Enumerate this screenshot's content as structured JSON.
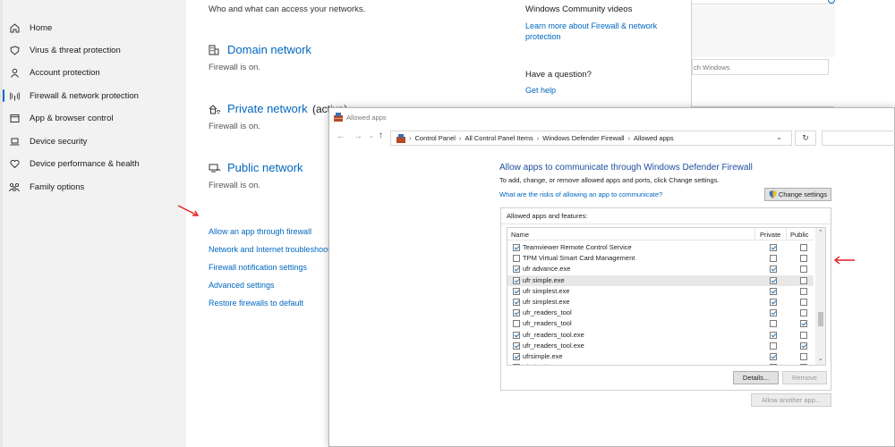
{
  "nav": {
    "items": [
      {
        "label": "Home",
        "icon": "home-icon",
        "active": false
      },
      {
        "label": "Virus & threat protection",
        "icon": "shield-icon",
        "active": false
      },
      {
        "label": "Account protection",
        "icon": "person-icon",
        "active": false
      },
      {
        "label": "Firewall & network protection",
        "icon": "antenna-icon",
        "active": true
      },
      {
        "label": "App & browser control",
        "icon": "app-window-icon",
        "active": false
      },
      {
        "label": "Device security",
        "icon": "laptop-icon",
        "active": false
      },
      {
        "label": "Device performance & health",
        "icon": "heart-icon",
        "active": false
      },
      {
        "label": "Family options",
        "icon": "family-icon",
        "active": false
      }
    ]
  },
  "main": {
    "intro": "Who and what can access your networks.",
    "networks": [
      {
        "title": "Domain network",
        "status": "Firewall is on.",
        "suffix": "",
        "icon": "domain-network-icon"
      },
      {
        "title": "Private network",
        "status": "Firewall is on.",
        "suffix": "(active)",
        "icon": "private-network-icon"
      },
      {
        "title": "Public network",
        "status": "Firewall is on.",
        "suffix": "",
        "icon": "public-network-icon"
      }
    ],
    "links": [
      "Allow an app through firewall",
      "Network and Internet troubleshooter",
      "Firewall notification settings",
      "Advanced settings",
      "Restore firewalls to default"
    ],
    "side": {
      "community_title": "Windows Community videos",
      "community_link_line1": "Learn more about Firewall & network",
      "community_link_line2": "protection",
      "question_title": "Have a question?",
      "help_link": "Get help"
    }
  },
  "top_right_window": {
    "search_placeholder": "ch Windows"
  },
  "allowed_apps": {
    "window_title": "Allowed apps",
    "breadcrumb": [
      "Control Panel",
      "All Control Panel Items",
      "Windows Defender Firewall",
      "Allowed apps"
    ],
    "heading": "Allow apps to communicate through Windows Defender Firewall",
    "instruction": "To add, change, or remove allowed apps and ports, click Change settings.",
    "risk_link": "What are the risks of allowing an app to communicate?",
    "change_settings": "Change settings",
    "list_label": "Allowed apps and features:",
    "columns": {
      "name": "Name",
      "private": "Private",
      "public": "Public"
    },
    "rows": [
      {
        "name": "Teamviewer Remote Control Service",
        "enabled": true,
        "private": true,
        "public": false
      },
      {
        "name": "TPM Virtual Smart Card Management",
        "enabled": false,
        "private": false,
        "public": false
      },
      {
        "name": "ufr advance.exe",
        "enabled": true,
        "private": true,
        "public": false
      },
      {
        "name": "ufr simple.exe",
        "enabled": true,
        "private": true,
        "public": false
      },
      {
        "name": "ufr simplest.exe",
        "enabled": true,
        "private": true,
        "public": false
      },
      {
        "name": "ufr simplest.exe",
        "enabled": true,
        "private": true,
        "public": false
      },
      {
        "name": "ufr_readers_tool",
        "enabled": true,
        "private": true,
        "public": false
      },
      {
        "name": "ufr_readers_tool",
        "enabled": false,
        "private": false,
        "public": true
      },
      {
        "name": "ufr_readers_tool.exe",
        "enabled": true,
        "private": true,
        "public": false
      },
      {
        "name": "ufr_readers_tool.exe",
        "enabled": true,
        "private": false,
        "public": true
      },
      {
        "name": "ufrsimple.exe",
        "enabled": true,
        "private": true,
        "public": false
      },
      {
        "name": "ufrsimple.exe",
        "enabled": true,
        "private": false,
        "public": true
      }
    ],
    "selected_row": 3,
    "details": "Details...",
    "remove": "Remove",
    "allow_another": "Allow another app..."
  },
  "colors": {
    "accent": "#0067c0",
    "annotation_arrow": "#e02020"
  }
}
